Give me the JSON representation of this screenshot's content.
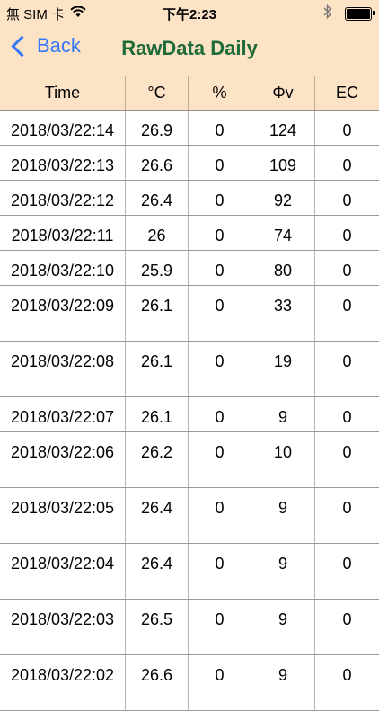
{
  "status_bar": {
    "carrier": "無 SIM 卡",
    "time": "下午2:23",
    "wifi_icon": "wifi-icon",
    "bluetooth_icon": "bluetooth-icon",
    "battery_icon": "battery-icon"
  },
  "nav": {
    "back_label": "Back",
    "title": "RawData Daily"
  },
  "table": {
    "columns": [
      "Time",
      "°C",
      "%",
      "Φv",
      "EC"
    ],
    "rows": [
      {
        "time": "2018/03/22:14",
        "temp": "26.9",
        "pct": "0",
        "phi": "124",
        "ec": "0"
      },
      {
        "time": "2018/03/22:13",
        "temp": "26.6",
        "pct": "0",
        "phi": "109",
        "ec": "0"
      },
      {
        "time": "2018/03/22:12",
        "temp": "26.4",
        "pct": "0",
        "phi": "92",
        "ec": "0"
      },
      {
        "time": "2018/03/22:11",
        "temp": "26",
        "pct": "0",
        "phi": "74",
        "ec": "0"
      },
      {
        "time": "2018/03/22:10",
        "temp": "25.9",
        "pct": "0",
        "phi": "80",
        "ec": "0"
      },
      {
        "time": "2018/03/22:09",
        "temp": "26.1",
        "pct": "0",
        "phi": "33",
        "ec": "0"
      },
      {
        "time": "2018/03/22:08",
        "temp": "26.1",
        "pct": "0",
        "phi": "19",
        "ec": "0"
      },
      {
        "time": "2018/03/22:07",
        "temp": "26.1",
        "pct": "0",
        "phi": "9",
        "ec": "0"
      },
      {
        "time": "2018/03/22:06",
        "temp": "26.2",
        "pct": "0",
        "phi": "10",
        "ec": "0"
      },
      {
        "time": "2018/03/22:05",
        "temp": "26.4",
        "pct": "0",
        "phi": "9",
        "ec": "0"
      },
      {
        "time": "2018/03/22:04",
        "temp": "26.4",
        "pct": "0",
        "phi": "9",
        "ec": "0"
      },
      {
        "time": "2018/03/22:03",
        "temp": "26.5",
        "pct": "0",
        "phi": "9",
        "ec": "0"
      },
      {
        "time": "2018/03/22:02",
        "temp": "26.6",
        "pct": "0",
        "phi": "9",
        "ec": "0"
      }
    ]
  },
  "colors": {
    "header_bg": "#fde3c6",
    "title_green": "#1f6b3a",
    "link_blue": "#3478f6"
  }
}
